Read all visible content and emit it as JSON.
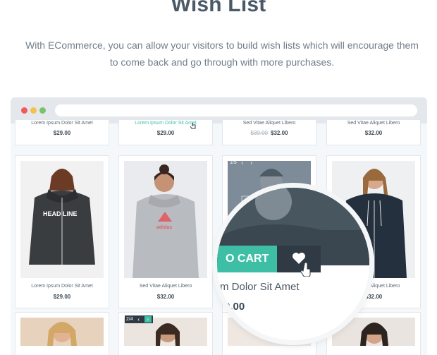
{
  "header": {
    "title": "Wish List",
    "subtitle_line1": "With ECommerce, you can allow your visitors to build wish lists which will encourage them",
    "subtitle_line2": "to come back and go through with more purchases."
  },
  "top_row": [
    {
      "name": "Lorem Ipsum Dolor Sit Amet",
      "price": "$29.00",
      "old_price": ""
    },
    {
      "name": "Lorem Ipsum Dolor Sit Amet",
      "price": "$29.00",
      "old_price": ""
    },
    {
      "name": "Sed Vitae Aliquet Libero",
      "price": "$32.00",
      "old_price": "$39.00"
    },
    {
      "name": "Sed Vitae Aliquet Libero",
      "price": "$32.00",
      "old_price": ""
    }
  ],
  "mid_row": [
    {
      "name": "Lorem Ipsum Dolor Sit Amet",
      "price": "$29.00",
      "print": "HEAD LINE"
    },
    {
      "name": "Sed Vitae Aliquet Libero",
      "price": "$32.00",
      "print": "adidas"
    },
    {
      "pager": "1/5"
    },
    {
      "name": "Sed Vitae Aliquet Libero",
      "price": "$32.00"
    }
  ],
  "bottom_row": {
    "pager": "2/4"
  },
  "lens": {
    "cart_label": "O CART",
    "name": "m Dolor Sit Amet",
    "price": "9.00"
  },
  "icons": [
    "heart-icon",
    "hand-cursor-icon",
    "chevron-left-icon",
    "chevron-right-icon"
  ],
  "colors": {
    "accent": "#3ebfa5",
    "dark": "#2f3a44",
    "title": "#4a5a68"
  }
}
